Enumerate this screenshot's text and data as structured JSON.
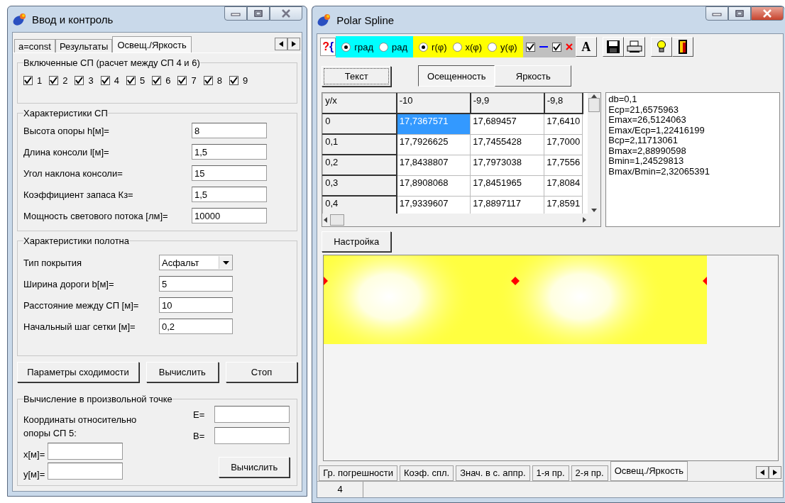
{
  "left_window": {
    "title": "Ввод и контроль",
    "tabs": [
      {
        "label": "a=const",
        "selected": false
      },
      {
        "label": "Результаты",
        "selected": false
      },
      {
        "label": "Освещ./Яркость",
        "selected": true
      }
    ],
    "lamps_group": {
      "title": "Включенные СП (расчет между СП 4 и 6)",
      "lamps": [
        {
          "label": "1",
          "checked": true
        },
        {
          "label": "2",
          "checked": true
        },
        {
          "label": "3",
          "checked": true
        },
        {
          "label": "4",
          "checked": true
        },
        {
          "label": "5",
          "checked": true
        },
        {
          "label": "6",
          "checked": true
        },
        {
          "label": "7",
          "checked": true
        },
        {
          "label": "8",
          "checked": true
        },
        {
          "label": "9",
          "checked": true
        }
      ]
    },
    "lamp_group": {
      "title": "Характеристики СП",
      "fields": [
        {
          "label": "Высота опоры h[м]=",
          "value": "8"
        },
        {
          "label": "Длина консоли l[м]=",
          "value": "1,5"
        },
        {
          "label": "Угол наклона консоли=",
          "value": "15"
        },
        {
          "label": "Коэффициент запаса Кз=",
          "value": "1,5"
        },
        {
          "label": "Мощность светового потока [лм]=",
          "value": "10000"
        }
      ]
    },
    "surface_group": {
      "title": "Характеристики полотна",
      "fields": [
        {
          "kind": "dropdown",
          "label": "Тип покрытия",
          "value": "Асфальт"
        },
        {
          "kind": "input",
          "label": "Ширина дороги b[м]=",
          "value": "5"
        },
        {
          "kind": "input",
          "label": "Расстояние между СП [м]=",
          "value": "10"
        },
        {
          "kind": "input",
          "label": "Начальный шаг сетки [м]=",
          "value": "0,2"
        }
      ]
    },
    "buttons": [
      "Параметры сходимости",
      "Вычислить",
      "Стоп"
    ],
    "point_group": {
      "title": "Вычисление в произвольной точке",
      "note": "Координаты относительно опоры СП 5:",
      "coords": [
        {
          "label": "x[м]="
        },
        {
          "label": "y[м]="
        }
      ],
      "results": [
        {
          "label": "E="
        },
        {
          "label": "B="
        }
      ],
      "button": "Вычислить"
    }
  },
  "right_window": {
    "title": "Polar Spline",
    "toolbar": {
      "help": [
        "?",
        "{"
      ],
      "units": [
        {
          "label": "град",
          "selected": true
        },
        {
          "label": "рад",
          "selected": false
        }
      ],
      "functions": [
        {
          "label": "r(φ)",
          "selected": true
        },
        {
          "label": "x(φ)",
          "selected": false
        },
        {
          "label": "y(φ)",
          "selected": false
        }
      ],
      "toggles": [
        {
          "kind": "line",
          "checked": true
        },
        {
          "kind": "cross",
          "checked": true
        }
      ],
      "font_button": "A"
    },
    "text_button": "Текст",
    "modes": [
      {
        "label": "Осещенность",
        "selected": true
      },
      {
        "label": "Яркость",
        "selected": false
      }
    ],
    "table": {
      "corner": "y/x",
      "columns": [
        "-10",
        "-9,9",
        "-9,8"
      ],
      "rows": [
        {
          "header": "0",
          "cells": [
            {
              "text": "17,7367571",
              "selected": true
            },
            {
              "text": "17,689457",
              "selected": false
            },
            {
              "text": "17,6410",
              "selected": false
            }
          ]
        },
        {
          "header": "0,1",
          "cells": [
            {
              "text": "17,7926625",
              "selected": false
            },
            {
              "text": "17,7455428",
              "selected": false
            },
            {
              "text": "17,7000",
              "selected": false
            }
          ]
        },
        {
          "header": "0,2",
          "cells": [
            {
              "text": "17,8438807",
              "selected": false
            },
            {
              "text": "17,7973038",
              "selected": false
            },
            {
              "text": "17,7556",
              "selected": false
            }
          ]
        },
        {
          "header": "0,3",
          "cells": [
            {
              "text": "17,8908068",
              "selected": false
            },
            {
              "text": "17,8451965",
              "selected": false
            },
            {
              "text": "17,8084",
              "selected": false
            }
          ]
        },
        {
          "header": "0,4",
          "cells": [
            {
              "text": "17,9339607",
              "selected": false
            },
            {
              "text": "17,8897117",
              "selected": false
            },
            {
              "text": "17,8591",
              "selected": false
            }
          ]
        }
      ]
    },
    "summary": [
      "db=0,1",
      "Ecp=21,6575963",
      "Emax=26,5124063",
      "Emax/Ecp=1,22416199",
      "Bcp=2,11713061",
      "Bmax=2,88990598",
      "Bmin=1,24529813",
      "Bmax/Bmin=2,32065391"
    ],
    "settings_button": "Настройка",
    "bottom_tabs": [
      {
        "label": "Гр. погрешности",
        "selected": false
      },
      {
        "label": "Коэф. спл.",
        "selected": false
      },
      {
        "label": "Знач. в с. аппр.",
        "selected": false
      },
      {
        "label": "1-я пр.",
        "selected": false
      },
      {
        "label": "2-я пр.",
        "selected": false
      },
      {
        "label": "Освещ./Яркость",
        "selected": true
      }
    ],
    "status_bar": {
      "cell": "4"
    }
  }
}
